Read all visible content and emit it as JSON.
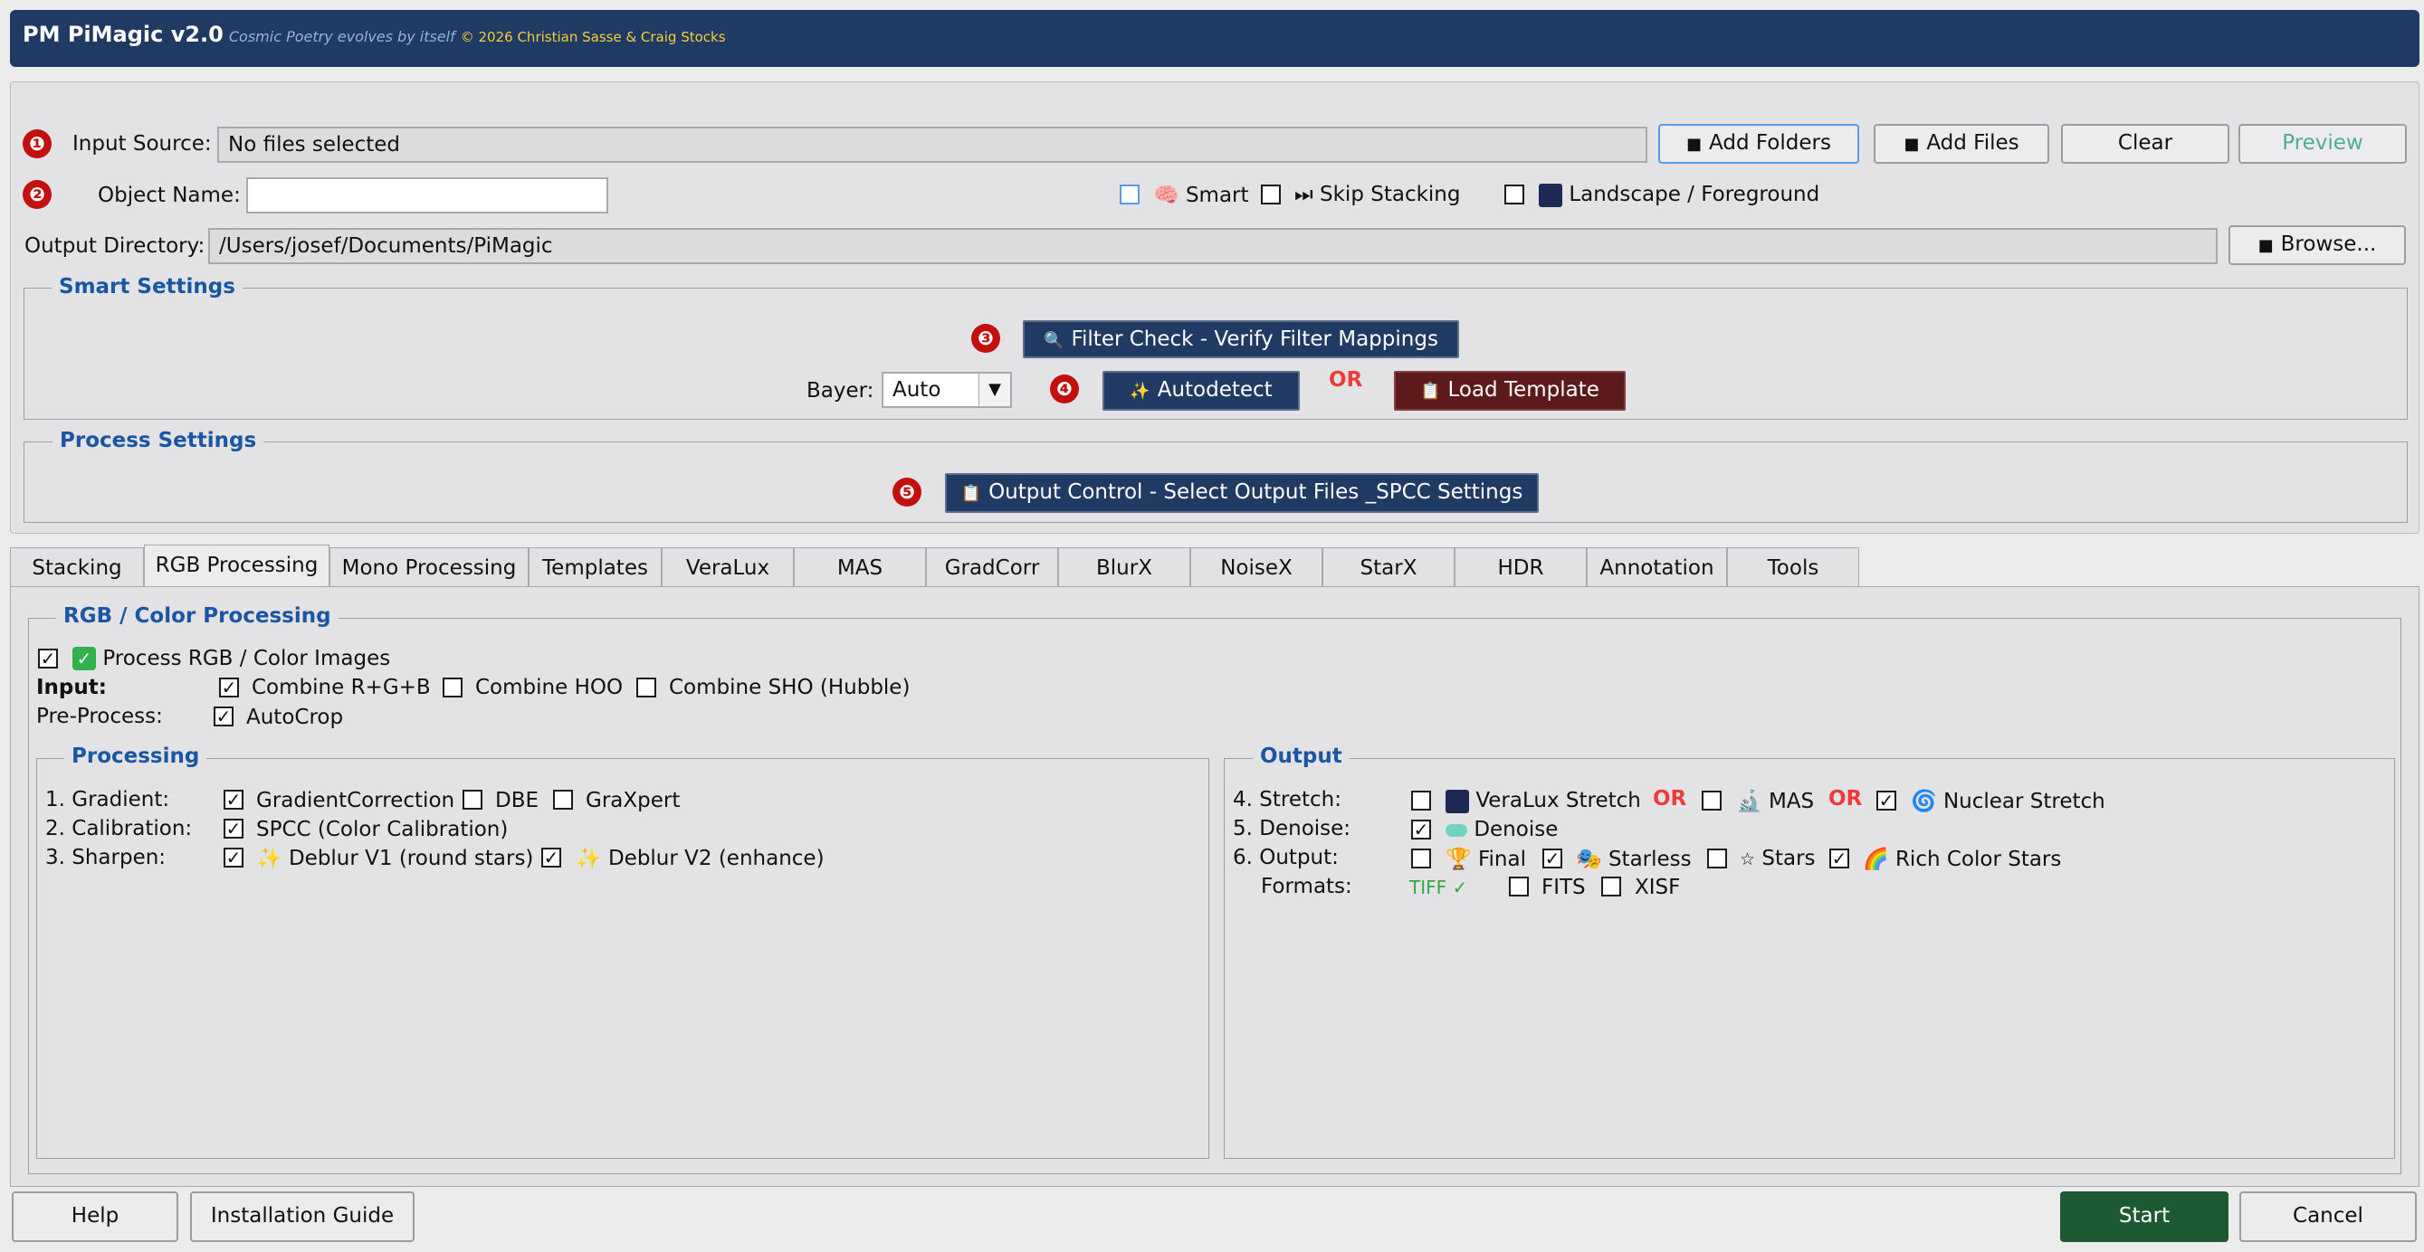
{
  "header": {
    "title": "PM PiMagic v2.0",
    "subtitle": "Cosmic Poetry evolves by itself",
    "copyright": "© 2026 Christian Sasse & Craig Stocks"
  },
  "steps": [
    "❶",
    "❷",
    "❸",
    "❹",
    "❺"
  ],
  "input": {
    "label": "Input Source:",
    "value": "No files selected",
    "add_folders": "Add Folders",
    "add_files": "Add Files",
    "clear": "Clear",
    "preview": "Preview"
  },
  "object": {
    "label": "Object Name:",
    "value": "",
    "smart": "Smart",
    "skip_stacking": "Skip Stacking",
    "landscape": "Landscape / Foreground"
  },
  "output_dir": {
    "label": "Output Directory:",
    "value": "/Users/josef/Documents/PiMagic",
    "browse": "Browse..."
  },
  "smart_settings": {
    "title": "Smart Settings",
    "filter_check": "Filter Check - Verify Filter Mappings",
    "bayer_label": "Bayer:",
    "bayer_value": "Auto",
    "autodetect": "Autodetect",
    "or": "OR",
    "load_template": "Load Template"
  },
  "process_settings": {
    "title": "Process Settings",
    "output_control": "Output Control - Select Output Files _SPCC Settings"
  },
  "tabs": [
    "Stacking",
    "RGB Processing",
    "Mono Processing",
    "Templates",
    "VeraLux",
    "MAS",
    "GradCorr",
    "BlurX",
    "NoiseX",
    "StarX",
    "HDR",
    "Annotation",
    "Tools"
  ],
  "active_tab": "RGB Processing",
  "rgb": {
    "title": "RGB / Color Processing",
    "process_rgb": "Process RGB / Color Images",
    "input_label": "Input:",
    "combine_rgb": "Combine R+G+B",
    "combine_hoo": "Combine HOO",
    "combine_sho": "Combine SHO (Hubble)",
    "preprocess_label": "Pre-Process:",
    "autocrop": "AutoCrop"
  },
  "processing": {
    "title": "Processing",
    "gradient_label": "1. Gradient:",
    "gradient_correction": "GradientCorrection",
    "dbe": "DBE",
    "graxpert": "GraXpert",
    "calibration_label": "2. Calibration:",
    "spcc": "SPCC (Color Calibration)",
    "sharpen_label": "3. Sharpen:",
    "deblur_v1": "Deblur V1 (round stars)",
    "deblur_v2": "Deblur V2 (enhance)"
  },
  "output": {
    "title": "Output",
    "stretch_label": "4. Stretch:",
    "veralux_stretch": "VeraLux Stretch",
    "or": "OR",
    "mas": "MAS",
    "nuclear_stretch": "Nuclear Stretch",
    "denoise_label": "5. Denoise:",
    "denoise": "Denoise",
    "output_label": "6. Output:",
    "final": "Final",
    "starless": "Starless",
    "stars": "Stars",
    "rich_color_stars": "Rich Color Stars",
    "formats_label": "Formats:",
    "tiff": "TIFF ✓",
    "fits": "FITS",
    "xisf": "XISF"
  },
  "footer": {
    "help": "Help",
    "installation_guide": "Installation Guide",
    "start": "Start",
    "cancel": "Cancel"
  },
  "colors": {
    "header_bg": "#1f3a63",
    "accent_blue": "#1a56a4",
    "step_red": "#c40f0f",
    "or_red": "#ee3b3b",
    "start_green": "#1c5a33",
    "template_maroon": "#5d1a1a"
  }
}
